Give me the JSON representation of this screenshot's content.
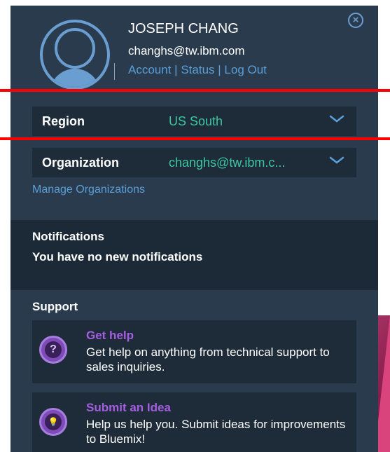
{
  "profile": {
    "name": "JOSEPH CHANG",
    "email": "changhs@tw.ibm.com",
    "links": {
      "account": "Account",
      "status": "Status",
      "logout": "Log Out",
      "separator": "|"
    },
    "close_icon": "close-icon",
    "close_glyph": "×"
  },
  "region": {
    "label": "Region",
    "value": "US South"
  },
  "organization": {
    "label": "Organization",
    "value": "changhs@tw.ibm.c..."
  },
  "manage_organizations": "Manage Organizations",
  "notifications": {
    "title": "Notifications",
    "text": "You have no new notifications"
  },
  "support": {
    "title": "Support",
    "items": [
      {
        "icon": "question-icon",
        "glyph": "?",
        "title": "Get help",
        "description": "Get help on anything from technical support to sales inquiries."
      },
      {
        "icon": "lightbulb-icon",
        "glyph": "💡",
        "title": "Submit an Idea",
        "description": "Help us help you. Submit ideas for improvements to Bluemix!"
      }
    ]
  },
  "colors": {
    "panel": "#2a3b4d",
    "row": "#1e2c3a",
    "accent_blue": "#5a9fd8",
    "accent_green": "#3ec6a0",
    "accent_purple": "#a45ee0",
    "highlight": "#ff0000"
  }
}
